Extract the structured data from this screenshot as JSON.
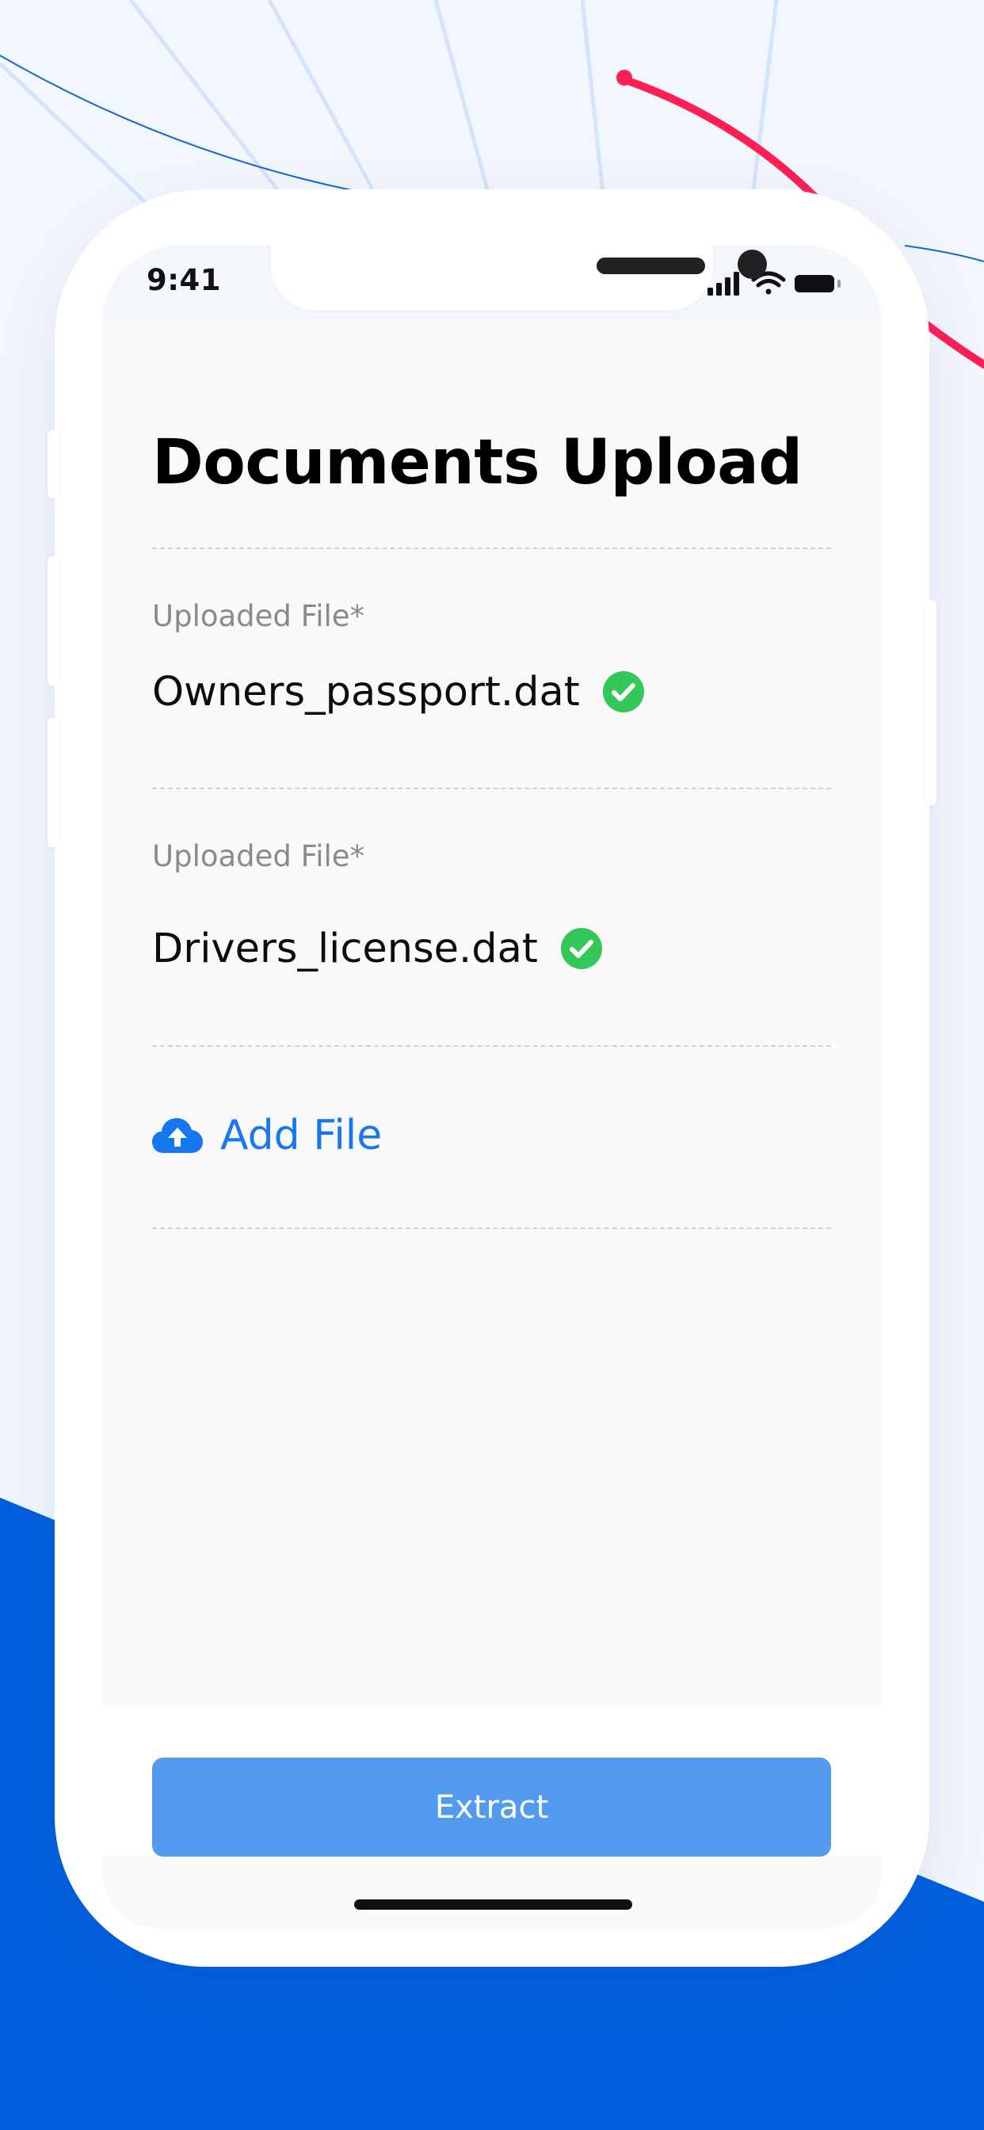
{
  "status_bar": {
    "time": "9:41",
    "icons": [
      "cellular-signal-icon",
      "wifi-icon",
      "battery-icon"
    ]
  },
  "page": {
    "title": "Documents Upload"
  },
  "files": [
    {
      "label": "Uploaded File*",
      "name": "Owners_passport.dat",
      "status_icon": "check-circle-icon"
    },
    {
      "label": "Uploaded File*",
      "name": "Drivers_license.dat",
      "status_icon": "check-circle-icon"
    }
  ],
  "add_file": {
    "label": "Add File",
    "icon": "cloud-upload-icon"
  },
  "actions": {
    "extract_label": "Extract"
  },
  "colors": {
    "accent": "#1677ee",
    "button": "#539bee",
    "success": "#34c759",
    "brand_blue": "#005fdd",
    "decor_red": "#ff1f55"
  }
}
